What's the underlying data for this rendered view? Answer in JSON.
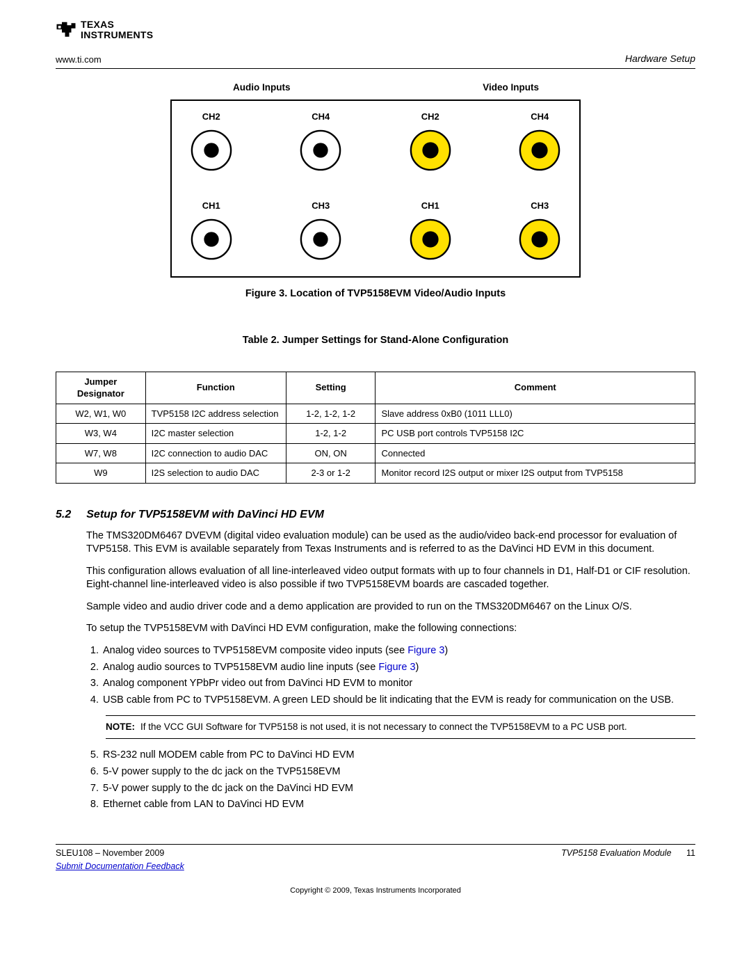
{
  "header": {
    "url": "www.ti.com",
    "section": "Hardware Setup",
    "logo": {
      "line1": "TEXAS",
      "line2": "INSTRUMENTS"
    }
  },
  "diagram": {
    "audio_header": "Audio Inputs",
    "video_header": "Video Inputs",
    "jacks": {
      "audio": [
        "CH2",
        "CH4",
        "CH1",
        "CH3"
      ],
      "video": [
        "CH2",
        "CH4",
        "CH1",
        "CH3"
      ]
    },
    "figure_caption": "Figure 3. Location of TVP5158EVM Video/Audio Inputs"
  },
  "table": {
    "caption": "Table 2. Jumper Settings for Stand-Alone Configuration",
    "headers": [
      "Jumper Designator",
      "Function",
      "Setting",
      "Comment"
    ],
    "rows": [
      {
        "designator": "W2, W1, W0",
        "function": "TVP5158 I2C address selection",
        "setting": "1-2, 1-2, 1-2",
        "comment": "Slave address 0xB0 (1011 LLL0)"
      },
      {
        "designator": "W3, W4",
        "function": "I2C master selection",
        "setting": "1-2, 1-2",
        "comment": "PC USB port controls TVP5158 I2C"
      },
      {
        "designator": "W7, W8",
        "function": "I2C connection to audio DAC",
        "setting": "ON, ON",
        "comment": "Connected"
      },
      {
        "designator": "W9",
        "function": "I2S selection to audio DAC",
        "setting": "2-3 or 1-2",
        "comment": "Monitor record I2S output or mixer I2S output from TVP5158"
      }
    ]
  },
  "section": {
    "number": "5.2",
    "title": "Setup for TVP5158EVM with DaVinci HD EVM",
    "paras": [
      "The TMS320DM6467 DVEVM (digital video evaluation module) can be used as the audio/video back-end processor for evaluation of TVP5158. This EVM is available separately from Texas Instruments and is referred to as the DaVinci HD EVM in this document.",
      "This configuration allows evaluation of all line-interleaved video output formats with up to four channels in D1, Half-D1 or CIF resolution. Eight-channel line-interleaved video is also possible if two TVP5158EVM boards are cascaded together.",
      "Sample video and audio driver code and a demo application are provided to run on the TMS320DM6467 on the Linux O/S.",
      "To setup the TVP5158EVM with DaVinci HD EVM configuration, make the following connections:"
    ],
    "steps_a": [
      {
        "text": "Analog video sources to TVP5158EVM composite video inputs (see ",
        "link": "Figure 3",
        "tail": ")"
      },
      {
        "text": "Analog audio sources to TVP5158EVM audio line inputs (see ",
        "link": "Figure 3",
        "tail": ")"
      },
      {
        "text": "Analog component YPbPr video out from DaVinci HD EVM to monitor",
        "link": "",
        "tail": ""
      },
      {
        "text": "USB cable from PC to TVP5158EVM. A green LED should be lit indicating that the EVM is ready for communication on the USB.",
        "link": "",
        "tail": ""
      }
    ],
    "note": {
      "label": "NOTE:",
      "text": "If the VCC GUI Software for TVP5158 is not used, it is not necessary to connect the TVP5158EVM to a PC USB port."
    },
    "steps_b": [
      "RS-232 null MODEM cable from PC to DaVinci HD EVM",
      "5-V power supply to the dc jack on the TVP5158EVM",
      "5-V power supply to the dc jack on the DaVinci HD EVM",
      "Ethernet cable from LAN to DaVinci HD EVM"
    ]
  },
  "footer": {
    "docnum": "SLEU108 – November 2009",
    "feedback": "Submit Documentation Feedback",
    "module": "TVP5158 Evaluation Module",
    "page": "11",
    "copyright": "Copyright © 2009, Texas Instruments Incorporated"
  }
}
